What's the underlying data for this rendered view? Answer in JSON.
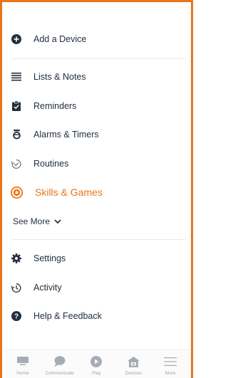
{
  "colors": {
    "accent": "#e8751a",
    "text": "#232f3e",
    "icon": "#232f3e",
    "tab_inactive": "#a6acb3"
  },
  "menu": {
    "add_device": {
      "label": "Add a Device",
      "icon": "plus-circle-icon"
    },
    "items": [
      {
        "label": "Lists & Notes",
        "icon": "list-icon"
      },
      {
        "label": "Reminders",
        "icon": "clipboard-check-icon"
      },
      {
        "label": "Alarms & Timers",
        "icon": "alarm-clock-icon"
      },
      {
        "label": "Routines",
        "icon": "check-circle-icon"
      },
      {
        "label": "Skills & Games",
        "icon": "skills-badge-icon",
        "active": true
      }
    ],
    "see_more": "See More",
    "bottom_items": [
      {
        "label": "Settings",
        "icon": "gear-icon"
      },
      {
        "label": "Activity",
        "icon": "history-icon"
      },
      {
        "label": "Help & Feedback",
        "icon": "help-icon"
      }
    ]
  },
  "tabbar": {
    "tabs": [
      {
        "label": "Home",
        "icon": "home-icon"
      },
      {
        "label": "Communicate",
        "icon": "chat-icon"
      },
      {
        "label": "Play",
        "icon": "play-icon"
      },
      {
        "label": "Devices",
        "icon": "devices-icon"
      },
      {
        "label": "More",
        "icon": "more-icon",
        "selected": true
      }
    ]
  }
}
